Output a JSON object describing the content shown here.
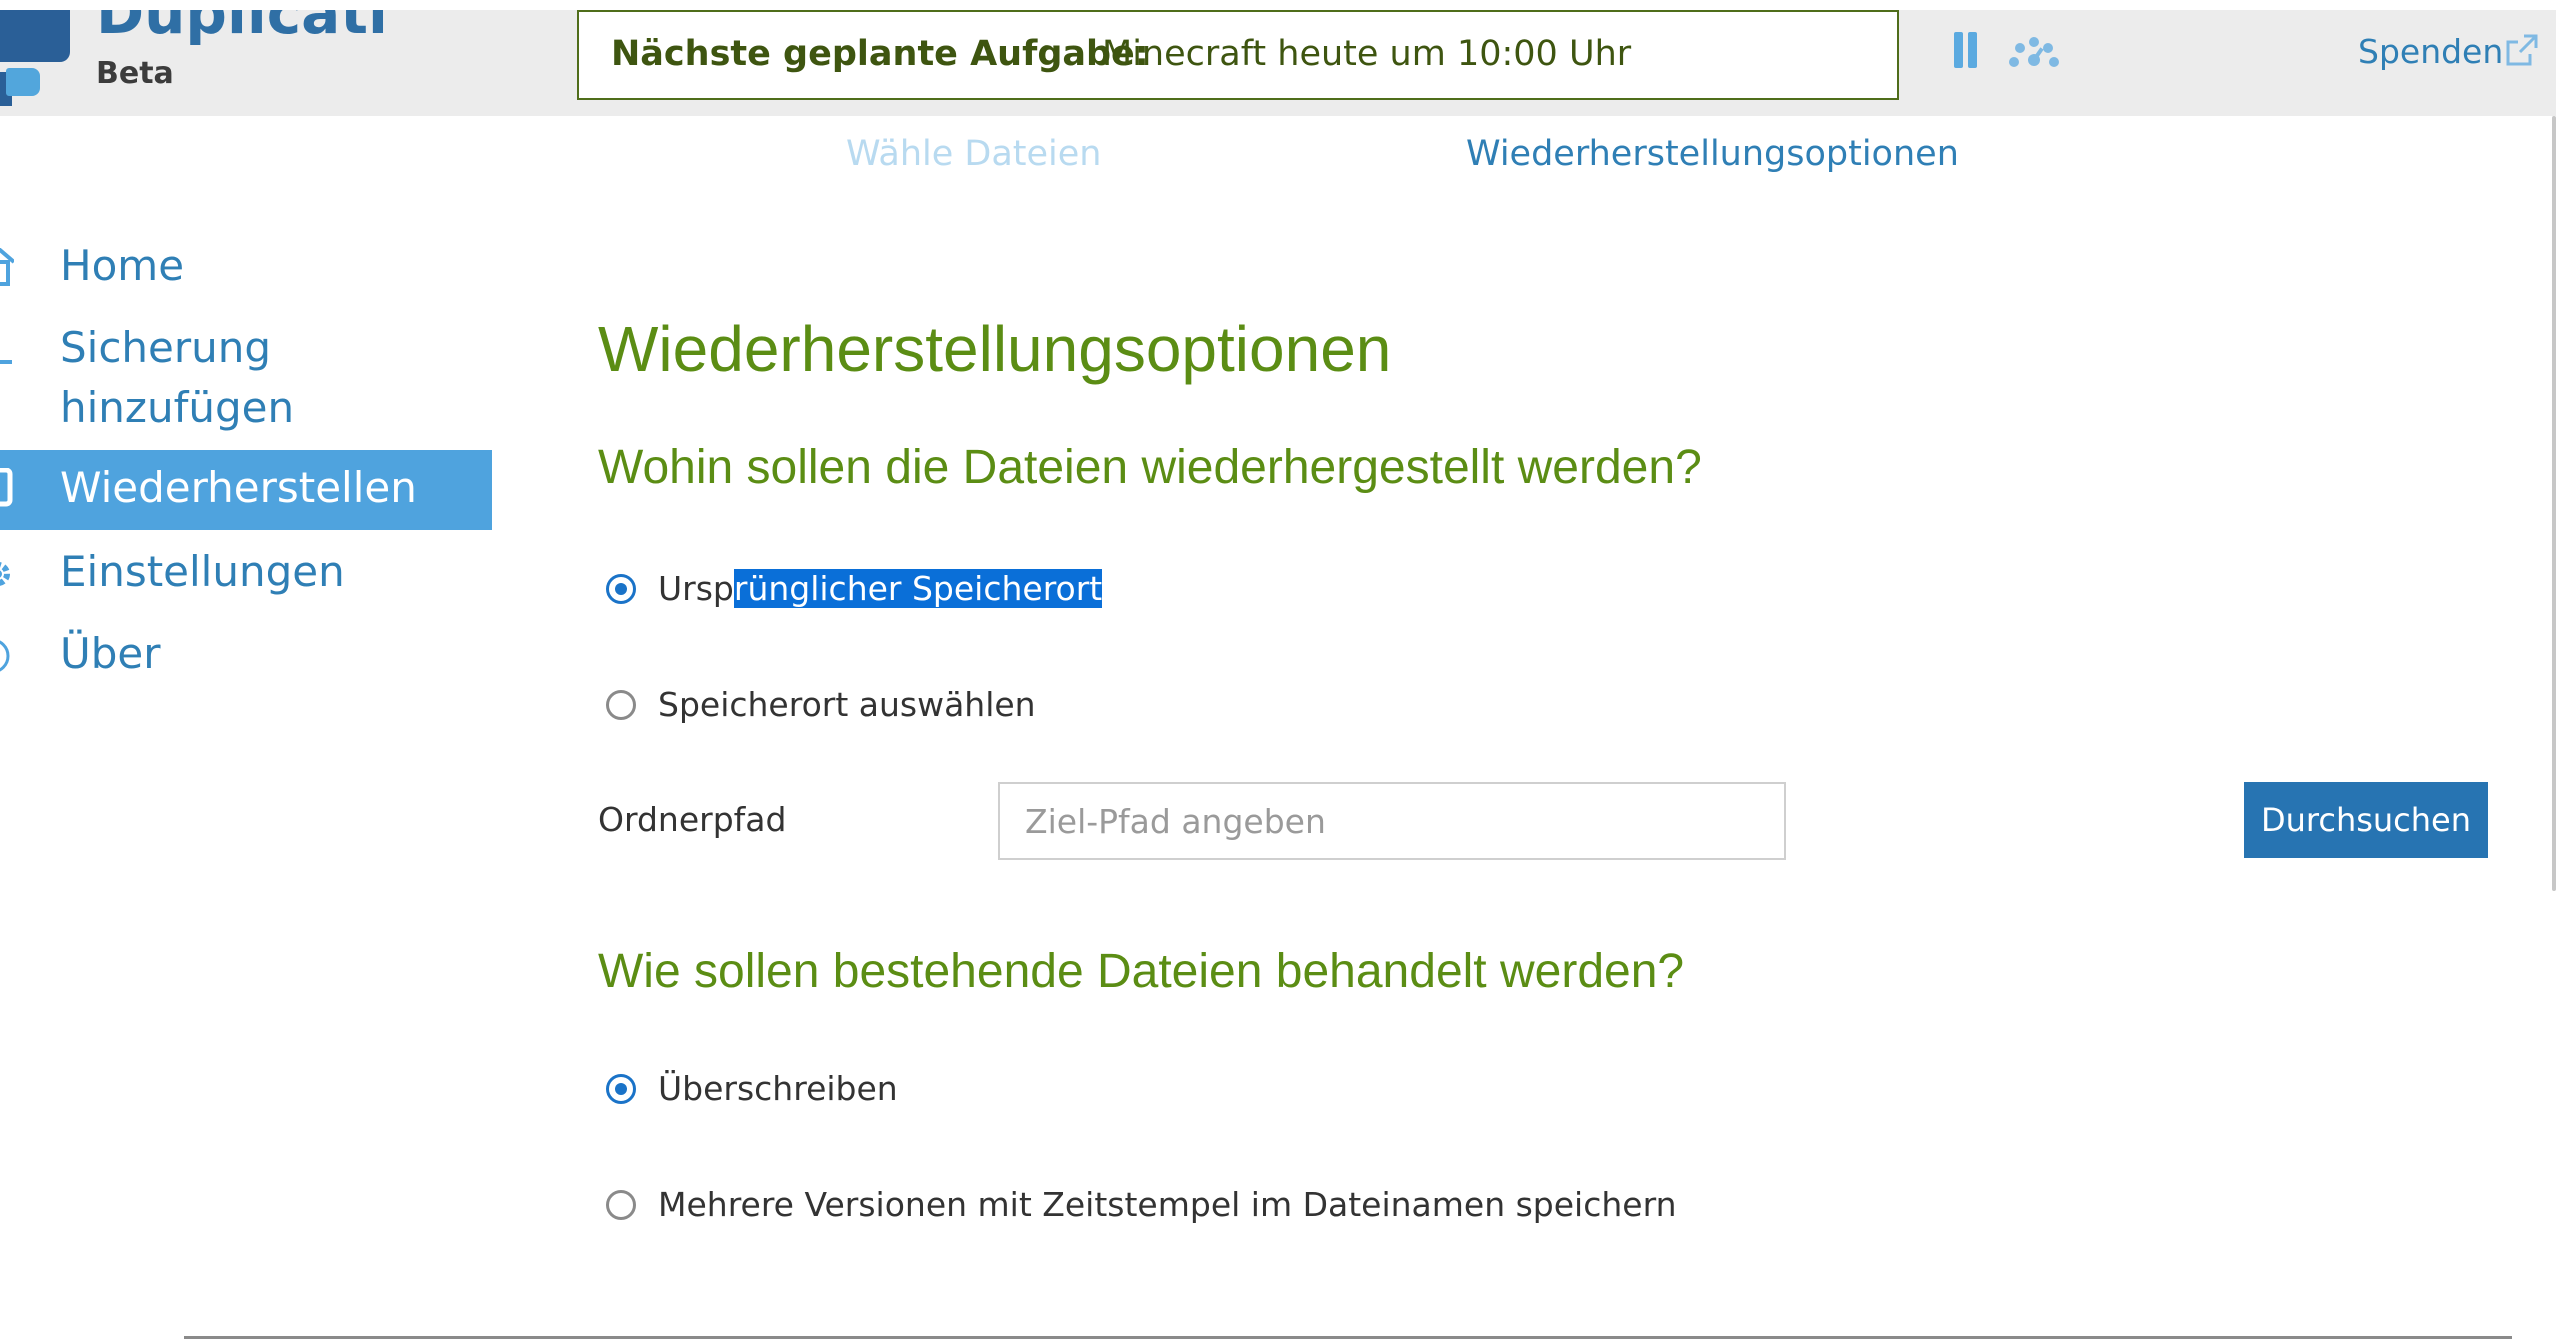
{
  "header": {
    "brand": "Duplicati",
    "brand_sub": "Beta",
    "next_task_label": "Nächste geplante Aufgabe:",
    "next_task_value": "Minecraft heute um 10:00 Uhr",
    "pause_icon": "pause-icon",
    "throttle_icon": "throttle-gauge-icon",
    "donate_label": "Spenden",
    "donate_icon": "external-link-icon"
  },
  "steps": {
    "choose_files": "Wähle Dateien",
    "restore_options": "Wiederherstellungsoptionen"
  },
  "sidebar": {
    "items": [
      {
        "label": "Home",
        "icon": "home-icon"
      },
      {
        "label": "Sicherung hinzufügen",
        "icon": "add-icon"
      },
      {
        "label": "Wiederherstellen",
        "icon": "restore-icon",
        "active": true
      },
      {
        "label": "Einstellungen",
        "icon": "gear-icon"
      },
      {
        "label": "Über",
        "icon": "info-icon"
      }
    ]
  },
  "main": {
    "title": "Wiederherstellungsoptionen",
    "where_question": "Wohin sollen die Dateien wiederhergestellt werden?",
    "location_options": {
      "original_prefix": "Ursp",
      "original_selected": "rünglicher Speicherort",
      "choose": "Speicherort auswählen"
    },
    "folder_label": "Ordnerpfad",
    "folder_placeholder": "Ziel-Pfad angeben",
    "folder_value": "",
    "browse_label": "Durchsuchen",
    "existing_question": "Wie sollen bestehende Dateien behandelt werden?",
    "existing_options": {
      "overwrite": "Überschreiben",
      "versions": "Mehrere Versionen mit Zeitstempel im Dateinamen speichern"
    }
  },
  "colors": {
    "accent": "#2f7fb5",
    "active_nav": "#4fa3de",
    "heading_green": "#5b8d14",
    "button": "#2774b2",
    "selection": "#0a6fd8"
  }
}
